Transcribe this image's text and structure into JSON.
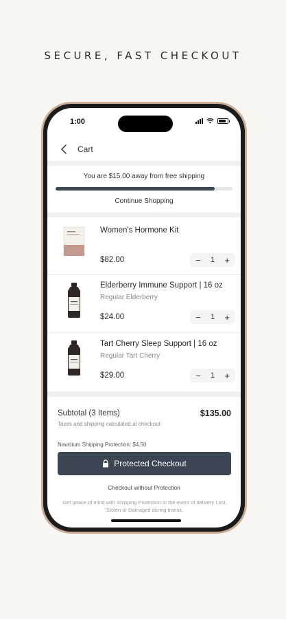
{
  "headline": "SECURE, FAST CHECKOUT",
  "status_bar": {
    "time": "1:00"
  },
  "header": {
    "title": "Cart"
  },
  "shipping": {
    "message": "You are $15.00 away from free shipping",
    "progress_fraction": 0.9,
    "continue_label": "Continue Shopping"
  },
  "items": [
    {
      "name": "Women's Hormone Kit",
      "variant": "",
      "price": "$82.00",
      "quantity": "1"
    },
    {
      "name": "Elderberry Immune Support | 16 oz",
      "variant": "Regular Elderberry",
      "price": "$24.00",
      "quantity": "1"
    },
    {
      "name": "Tart Cherry Sleep Support | 16 oz",
      "variant": "Regular Tart Cherry",
      "price": "$29.00",
      "quantity": "1"
    }
  ],
  "summary": {
    "subtotal_label": "Subtotal (3 Items)",
    "subtotal_value": "$135.00",
    "taxes_note": "Taxes and shipping calculated at checkout",
    "protection_label": "Navidium Shipping Protection: $4.50",
    "checkout_label": "Protected Checkout",
    "without_label": "Checkout without Protection",
    "note": "Get peace of mind with Shipping Protection in the event of delivery Lost, Stolen or Damaged during transit."
  },
  "colors": {
    "accent": "#3a4652",
    "background": "#f8f6f2",
    "frame": "#c9ad96"
  }
}
